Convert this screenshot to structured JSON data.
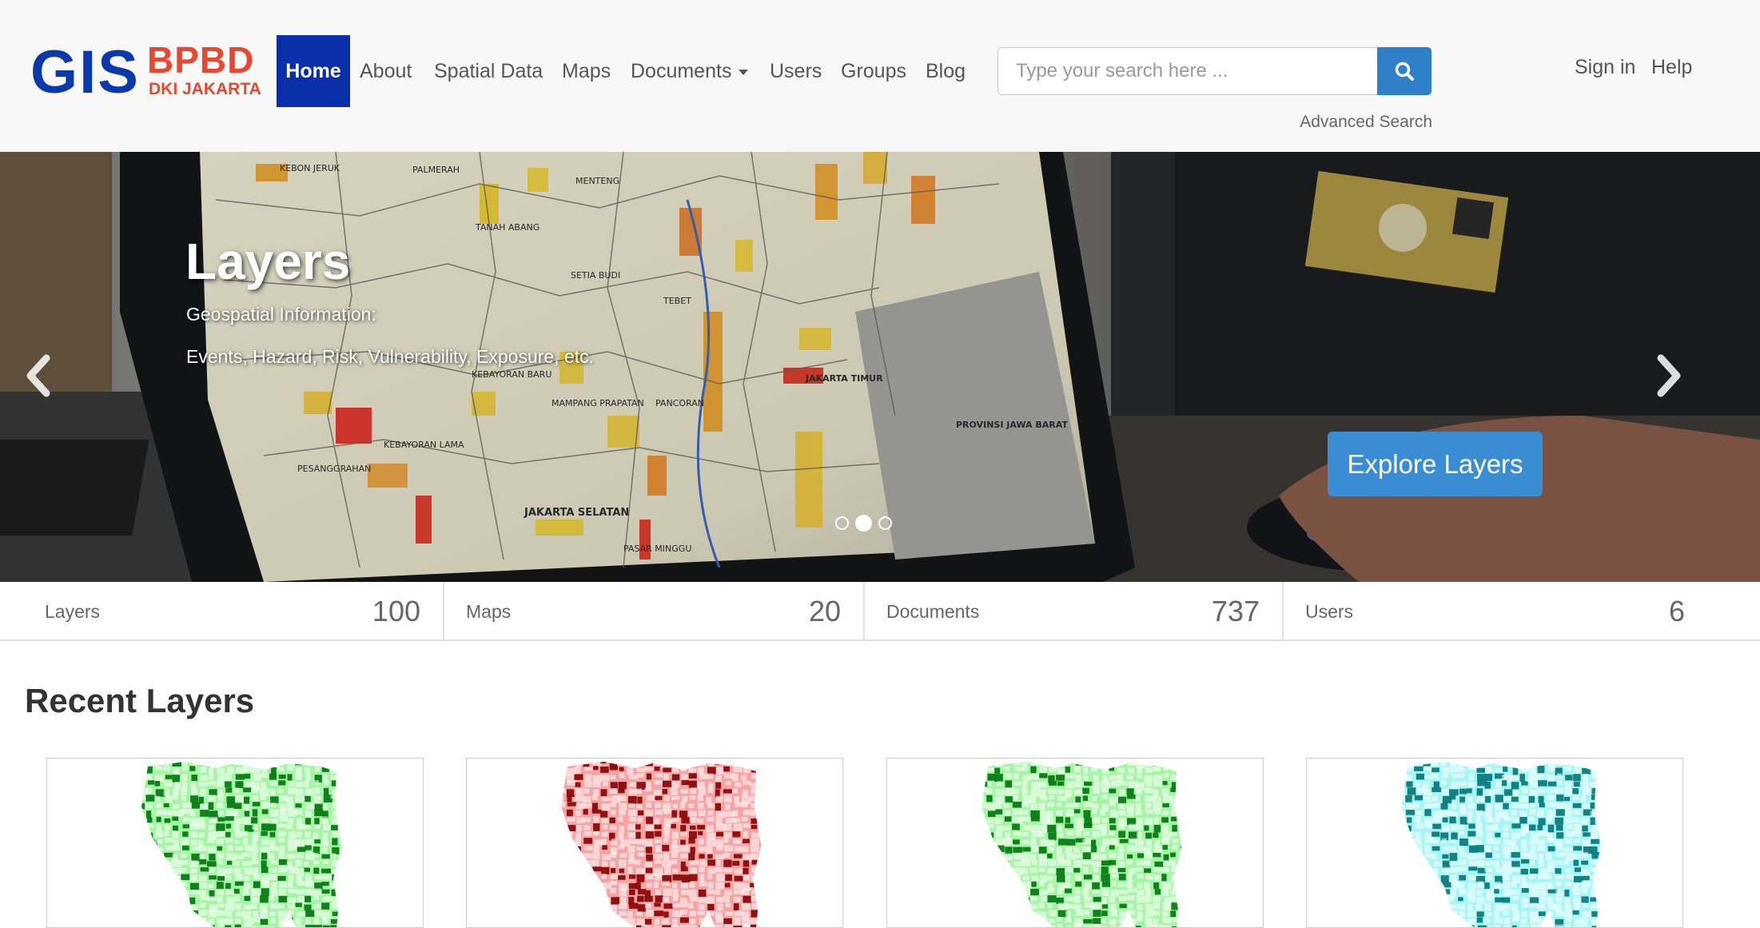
{
  "brand": {
    "gis": "GIS",
    "bpbd": "BPBD",
    "dki": "DKI JAKARTA",
    "primary_color": "#0a2fa8",
    "accent_color": "#e8482f"
  },
  "nav": {
    "home": "Home",
    "about": "About",
    "spatial_data": "Spatial Data",
    "maps": "Maps",
    "documents": "Documents",
    "users": "Users",
    "groups": "Groups",
    "blog": "Blog"
  },
  "search": {
    "placeholder": "Type your search here ...",
    "button_icon": "search-icon",
    "advanced": "Advanced Search"
  },
  "account": {
    "signin": "Sign in",
    "help": "Help"
  },
  "hero": {
    "title": "Layers",
    "line1": "Geospatial Information:",
    "line2": "Events, Hazard, Risk, Vulnerability, Exposure, etc.",
    "button": "Explore Layers",
    "active_slide": 2,
    "slide_count": 3,
    "map_labels": [
      "KEBON JERUK",
      "PALMERAH",
      "MENTENG",
      "TANAH ABANG",
      "SETIA BUDI",
      "TEBET",
      "KEBAYORAN BARU",
      "MAMPANG PRAPATAN",
      "PANCORAN",
      "JAKARTA TIMUR",
      "JAKARTA SELATAN",
      "PESANGGRAHAN",
      "KEBAYORAN LAMA",
      "PASAR MINGGU",
      "PROVINSI JAWA BARAT"
    ]
  },
  "stats": [
    {
      "label": "Layers",
      "count": "100"
    },
    {
      "label": "Maps",
      "count": "20"
    },
    {
      "label": "Documents",
      "count": "737"
    },
    {
      "label": "Users",
      "count": "6"
    }
  ],
  "recent": {
    "title": "Recent Layers",
    "thumbnails": [
      {
        "fill": "#a6f5a6",
        "dark": "#087a14"
      },
      {
        "fill": "#f5a3a3",
        "dark": "#8a0a0a"
      },
      {
        "fill": "#a6f5a6",
        "dark": "#087a14"
      },
      {
        "fill": "#a8f5f5",
        "dark": "#0c7b7b"
      }
    ]
  }
}
